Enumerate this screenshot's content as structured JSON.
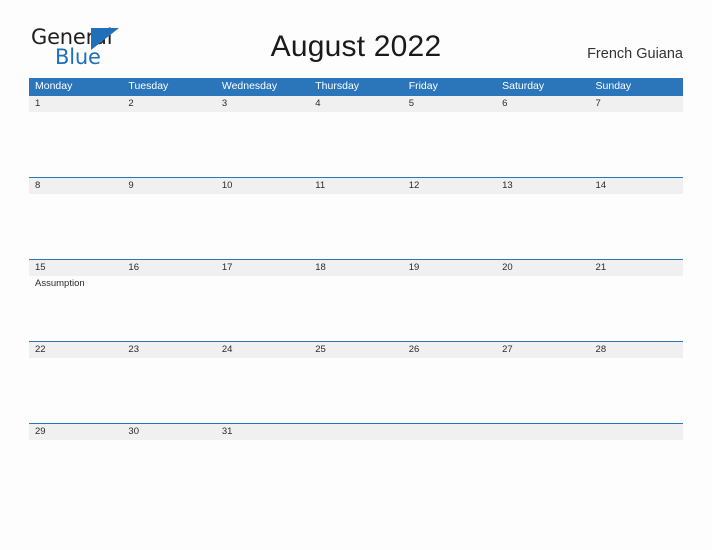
{
  "logo": {
    "word_one": "General",
    "word_two": "Blue",
    "brand_color": "#1f70b8",
    "triangle_icon": "triangle-icon"
  },
  "header": {
    "title": "August 2022",
    "region": "French Guiana"
  },
  "colors": {
    "header_blue": "#2b76bb",
    "date_band_gray": "#f0f0f0",
    "page_background": "#fdfdfd",
    "text_dark": "#2b2b2b"
  },
  "calendar": {
    "weekdays": [
      "Monday",
      "Tuesday",
      "Wednesday",
      "Thursday",
      "Friday",
      "Saturday",
      "Sunday"
    ],
    "weeks": [
      {
        "dates": [
          "1",
          "2",
          "3",
          "4",
          "5",
          "6",
          "7"
        ],
        "events": [
          "",
          "",
          "",
          "",
          "",
          "",
          ""
        ]
      },
      {
        "dates": [
          "8",
          "9",
          "10",
          "11",
          "12",
          "13",
          "14"
        ],
        "events": [
          "",
          "",
          "",
          "",
          "",
          "",
          ""
        ]
      },
      {
        "dates": [
          "15",
          "16",
          "17",
          "18",
          "19",
          "20",
          "21"
        ],
        "events": [
          "Assumption",
          "",
          "",
          "",
          "",
          "",
          ""
        ]
      },
      {
        "dates": [
          "22",
          "23",
          "24",
          "25",
          "26",
          "27",
          "28"
        ],
        "events": [
          "",
          "",
          "",
          "",
          "",
          "",
          ""
        ]
      },
      {
        "dates": [
          "29",
          "30",
          "31",
          "",
          "",
          "",
          ""
        ],
        "events": [
          "",
          "",
          "",
          "",
          "",
          "",
          ""
        ]
      }
    ]
  }
}
